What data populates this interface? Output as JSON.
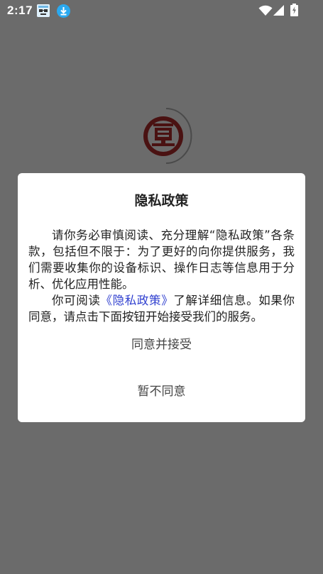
{
  "status_bar": {
    "time": "2:17"
  },
  "icons": {
    "notification_app": "app-notification-icon",
    "notification_download": "download-icon",
    "wifi": "wifi-icon",
    "signal": "cellular-signal-icon",
    "battery": "battery-charging-icon",
    "logo": "app-logo"
  },
  "colors": {
    "overlay_background": "#6b6b6b",
    "dialog_background": "#ffffff",
    "link": "#2f3fcf",
    "logo_red": "#7a1c1c",
    "download_blue": "#2aa9f0"
  },
  "dialog": {
    "title": "隐私政策",
    "paragraph1": "请你务必审慎阅读、充分理解“隐私政策”各条款，包括但不限于：为了更好的向你提供服务，我们需要收集你的设备标识、操作日志等信息用于分析、优化应用性能。",
    "paragraph2_before": "你可阅读",
    "paragraph2_link": "《隐私政策》",
    "paragraph2_after": "了解详细信息。如果你同意，请点击下面按钮开始接受我们的服务。",
    "agree_label": "同意并接受",
    "disagree_label": "暂不同意"
  }
}
